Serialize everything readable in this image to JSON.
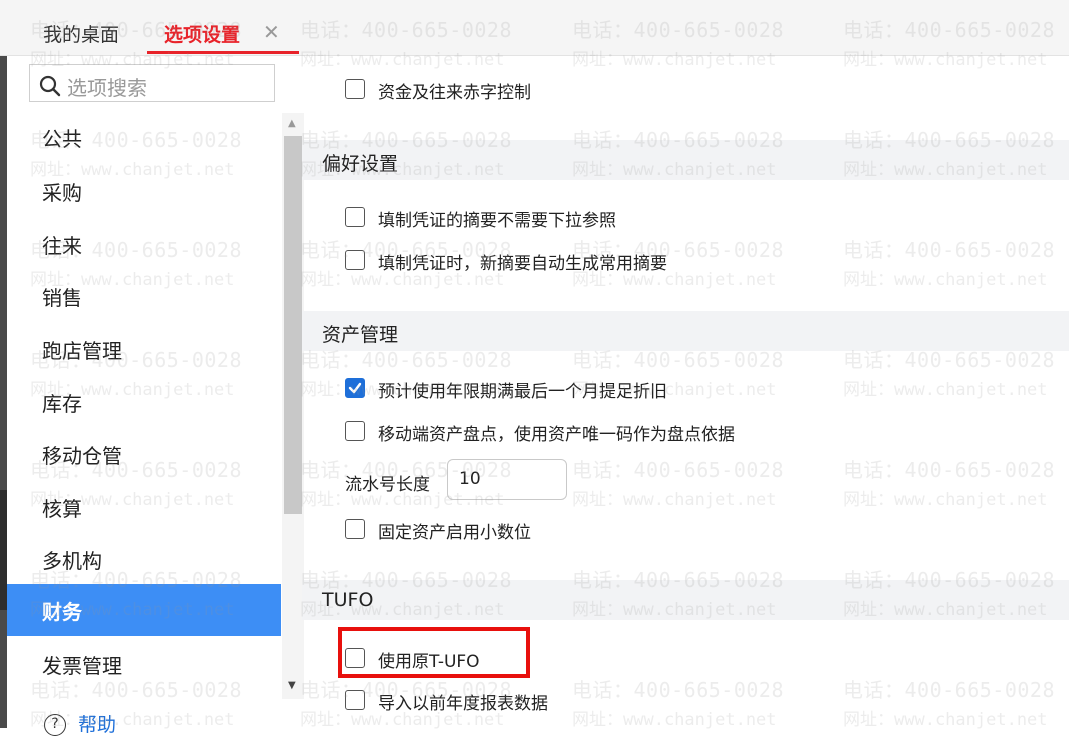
{
  "tabs": {
    "home": "我的桌面",
    "active": "选项设置",
    "close": "✕"
  },
  "search": {
    "placeholder": "选项搜索"
  },
  "nav": {
    "items": [
      {
        "label": "公共"
      },
      {
        "label": "采购"
      },
      {
        "label": "往来"
      },
      {
        "label": "销售"
      },
      {
        "label": "跑店管理"
      },
      {
        "label": "库存"
      },
      {
        "label": "移动仓管"
      },
      {
        "label": "核算"
      },
      {
        "label": "多机构"
      },
      {
        "label": "财务",
        "active": true
      },
      {
        "label": "发票管理"
      }
    ],
    "help": "帮助"
  },
  "content": {
    "top_option": {
      "label": "资金及往来赤字控制",
      "checked": false
    },
    "sections": {
      "preferences": {
        "title": "偏好设置",
        "options": [
          {
            "label": "填制凭证的摘要不需要下拉参照",
            "checked": false
          },
          {
            "label": "填制凭证时，新摘要自动生成常用摘要",
            "checked": false
          }
        ]
      },
      "assets": {
        "title": "资产管理",
        "options": [
          {
            "label": "预计使用年限期满最后一个月提足折旧",
            "checked": true
          },
          {
            "label": "移动端资产盘点，使用资产唯一码作为盘点依据",
            "checked": false
          },
          {
            "label": "固定资产启用小数位",
            "checked": false
          }
        ],
        "serial_length": {
          "label": "流水号长度",
          "value": "10"
        }
      },
      "tufo": {
        "title": "TUFO",
        "options": [
          {
            "label": "使用原T-UFO",
            "checked": false
          },
          {
            "label": "导入以前年度报表数据",
            "checked": false
          }
        ]
      }
    }
  },
  "watermark": {
    "phone": "电话：400-665-0028",
    "site": "网址：www.chanjet.net"
  },
  "colors": {
    "accent": "#e8232a",
    "active_nav": "#3d8ef5",
    "checkbox": "#1e6fd9",
    "highlight": "#e8100d"
  }
}
